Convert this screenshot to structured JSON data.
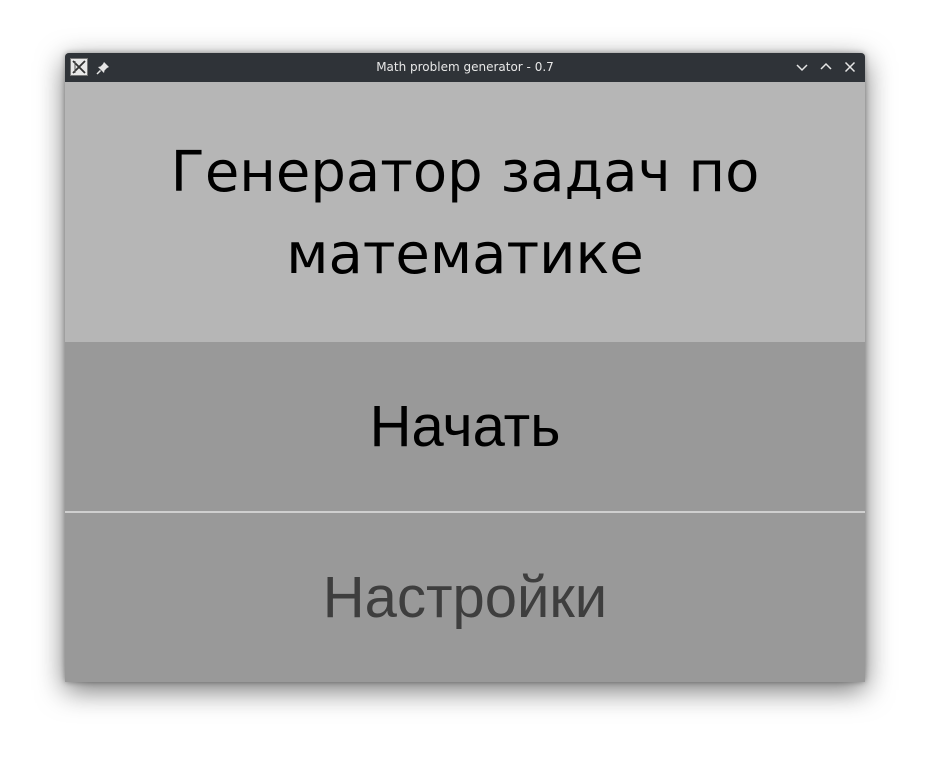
{
  "window": {
    "title": "Math problem generator - 0.7",
    "icons": {
      "app": "app-icon",
      "pin": "pin-icon",
      "minimize": "chevron-down-icon",
      "maximize": "chevron-up-icon",
      "close": "close-icon"
    }
  },
  "header": {
    "title": "Генератор задач по математике"
  },
  "menu": {
    "start_label": "Начать",
    "settings_label": "Настройки"
  },
  "colors": {
    "titlebar": "#2f3338",
    "header_bg": "#b6b6b6",
    "button_bg": "#999999",
    "divider": "#cfcfcf",
    "settings_text": "#3e3e3e"
  }
}
